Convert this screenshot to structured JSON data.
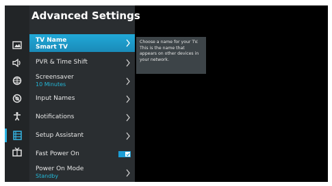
{
  "header": {
    "title": "Advanced Settings"
  },
  "menu": [
    {
      "label": "TV Name",
      "value": "Smart TV"
    },
    {
      "label": "PVR & Time Shift"
    },
    {
      "label": "Screensaver",
      "value": "10 Minutes"
    },
    {
      "label": "Input Names"
    },
    {
      "label": "Notifications"
    },
    {
      "label": "Setup Assistant"
    },
    {
      "label": "Fast Power On",
      "toggle": true
    },
    {
      "label": "Power On Mode",
      "value": "Standby"
    }
  ],
  "tooltip": {
    "text": "Choose a name for your TV. This is the name that appears on other devices in your network."
  },
  "sidebar_icons": [
    "picture-icon",
    "sound-icon",
    "network-icon",
    "broadcast-icon",
    "accessibility-icon",
    "system-icon",
    "channels-icon"
  ],
  "colors": {
    "accent": "#21a9d8",
    "panel": "#2a2e31",
    "value_text": "#23b8d8"
  }
}
